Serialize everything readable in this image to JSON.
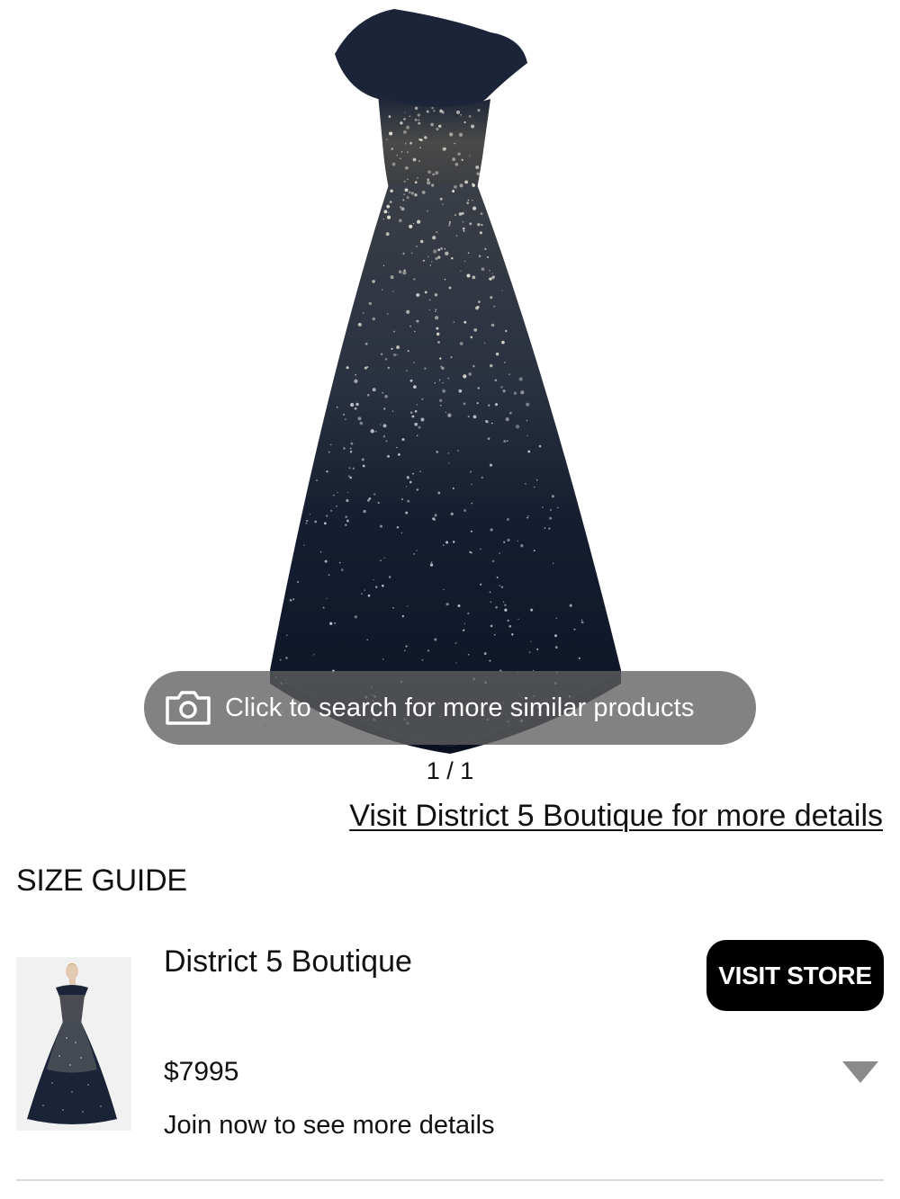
{
  "gallery": {
    "image_icon": "dress-image",
    "search_prompt": "Click to search for more similar products",
    "search_icon": "camera-icon",
    "counter": "1 / 1"
  },
  "visit_link": "Visit District 5 Boutique for more details",
  "size_guide": "SIZE GUIDE",
  "listing": {
    "thumbnail_icon": "model-dress-thumbnail",
    "store_name": "District 5 Boutique",
    "visit_store_label": "VISIT STORE",
    "price": "$7995",
    "join_text": "Join now to see more details",
    "expand_icon": "triangle-down-icon"
  },
  "colors": {
    "dress_navy": "#111a2e",
    "pill_bg": "#5f5f5f",
    "button_bg": "#000000",
    "divider": "#d9d9d9"
  }
}
